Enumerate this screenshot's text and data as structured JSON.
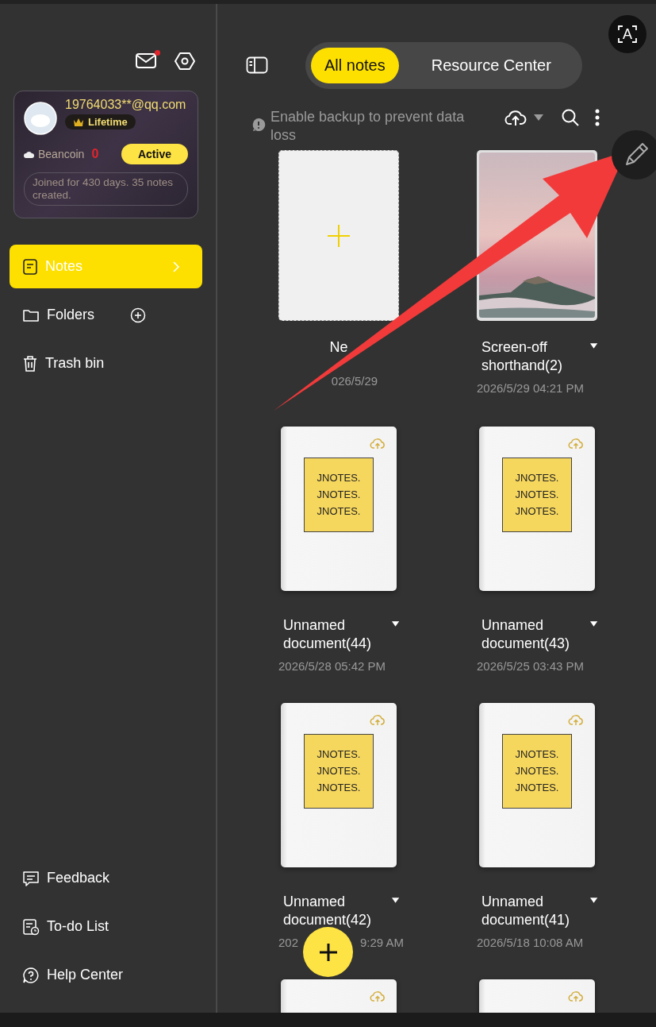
{
  "ocr_button": {
    "glyph": "A"
  },
  "sidebar": {
    "mail_unread": true,
    "profile": {
      "email": "19764033**@qq.com",
      "badge": "Lifetime",
      "coin_label": "Beancoin",
      "coin_count": "0",
      "status_button": "Active",
      "summary": "Joined for 430 days. 35 notes created."
    },
    "nav": [
      {
        "label": "Notes",
        "selected": true,
        "kind": "notes"
      },
      {
        "label": "Folders",
        "selected": false,
        "kind": "folders"
      },
      {
        "label": "Trash bin",
        "selected": false,
        "kind": "trash"
      }
    ],
    "footer": [
      {
        "label": "Feedback",
        "kind": "feedback"
      },
      {
        "label": "To-do List",
        "kind": "todo"
      },
      {
        "label": "Help Center",
        "kind": "help"
      }
    ]
  },
  "tabs": [
    {
      "label": "All notes",
      "selected": true
    },
    {
      "label": "Resource Center",
      "selected": false
    }
  ],
  "backup_notice": "Enable backup to prevent data loss",
  "notes": [
    {
      "kind": "new",
      "title": "Ne",
      "date": "026/5/29"
    },
    {
      "kind": "picture",
      "title": "Screen-off shorthand(2)",
      "date": "2026/5/29 04:21 PM"
    },
    {
      "kind": "document",
      "cover_lines": [
        "JNOTES.",
        "JNOTES.",
        "JNOTES."
      ],
      "title": "Unnamed document(44)",
      "date": "2026/5/28 05:42 PM"
    },
    {
      "kind": "document",
      "cover_lines": [
        "JNOTES.",
        "JNOTES.",
        "JNOTES."
      ],
      "title": "Unnamed document(43)",
      "date": "2026/5/25 03:43 PM"
    },
    {
      "kind": "document",
      "cover_lines": [
        "JNOTES.",
        "JNOTES.",
        "JNOTES."
      ],
      "title": "Unnamed document(42)",
      "date_parts": [
        "202",
        "9:29 AM"
      ]
    },
    {
      "kind": "document",
      "cover_lines": [
        "JNOTES.",
        "JNOTES.",
        "JNOTES."
      ],
      "title": "Unnamed document(41)",
      "date": "2026/5/18 10:08 AM"
    },
    {
      "kind": "document"
    },
    {
      "kind": "document"
    }
  ]
}
